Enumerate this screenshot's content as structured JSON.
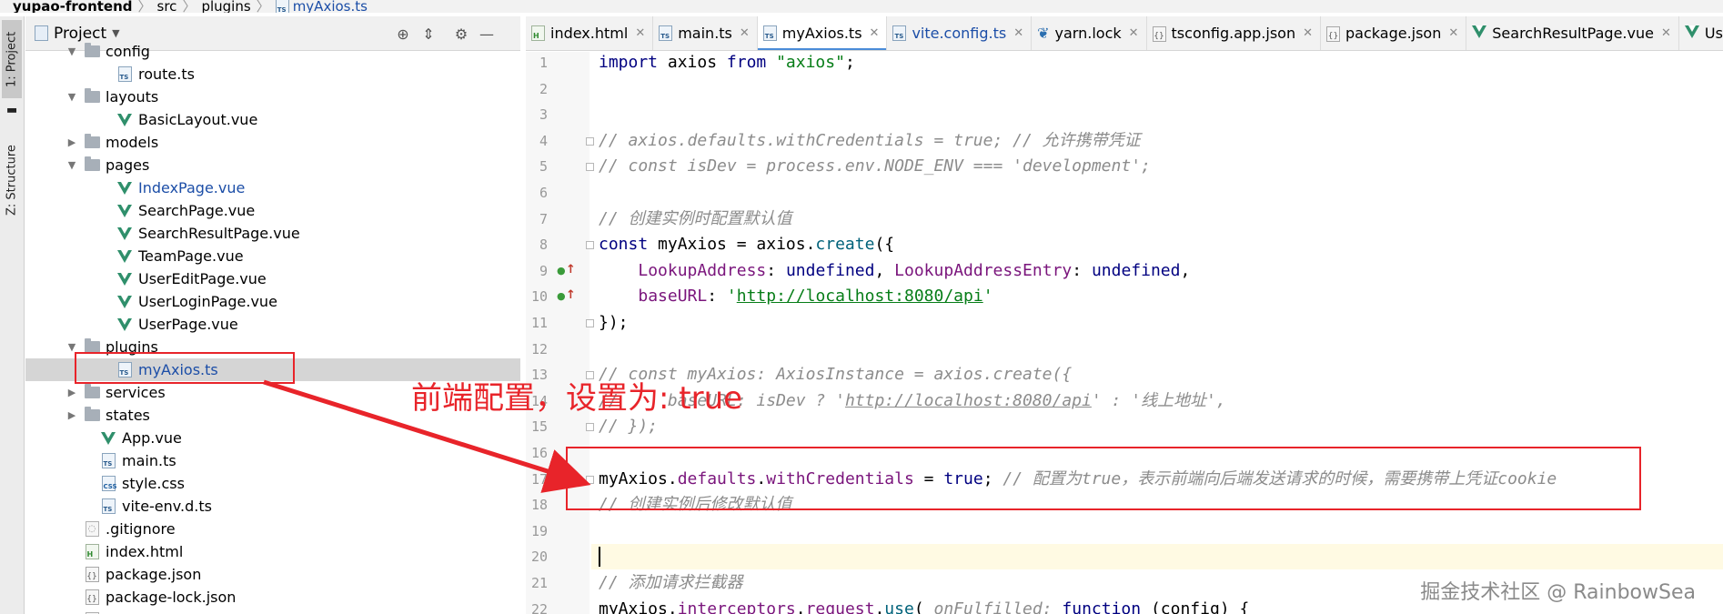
{
  "breadcrumb": [
    "yupao-frontend",
    "src",
    "plugins",
    "myAxios.ts"
  ],
  "toolstrip": {
    "project_tab": "1: Project",
    "structure_tab": "Z: Structure"
  },
  "project_panel": {
    "title": "Project",
    "tree": [
      {
        "label": "config",
        "kind": "folder",
        "expanded": true,
        "indent": 2
      },
      {
        "label": "route.ts",
        "kind": "ts",
        "indent": 4
      },
      {
        "label": "layouts",
        "kind": "folder",
        "expanded": true,
        "indent": 2
      },
      {
        "label": "BasicLayout.vue",
        "kind": "vue",
        "indent": 4
      },
      {
        "label": "models",
        "kind": "folder",
        "expanded": false,
        "indent": 2
      },
      {
        "label": "pages",
        "kind": "folder",
        "expanded": true,
        "indent": 2
      },
      {
        "label": "IndexPage.vue",
        "kind": "vue",
        "indent": 4,
        "highlight": true
      },
      {
        "label": "SearchPage.vue",
        "kind": "vue",
        "indent": 4
      },
      {
        "label": "SearchResultPage.vue",
        "kind": "vue",
        "indent": 4
      },
      {
        "label": "TeamPage.vue",
        "kind": "vue",
        "indent": 4
      },
      {
        "label": "UserEditPage.vue",
        "kind": "vue",
        "indent": 4
      },
      {
        "label": "UserLoginPage.vue",
        "kind": "vue",
        "indent": 4
      },
      {
        "label": "UserPage.vue",
        "kind": "vue",
        "indent": 4
      },
      {
        "label": "plugins",
        "kind": "folder",
        "expanded": true,
        "indent": 2
      },
      {
        "label": "myAxios.ts",
        "kind": "ts",
        "indent": 4,
        "selected": true
      },
      {
        "label": "services",
        "kind": "folder",
        "expanded": false,
        "indent": 2
      },
      {
        "label": "states",
        "kind": "folder",
        "expanded": false,
        "indent": 2
      },
      {
        "label": "App.vue",
        "kind": "vue",
        "indent": 3
      },
      {
        "label": "main.ts",
        "kind": "ts",
        "indent": 3
      },
      {
        "label": "style.css",
        "kind": "css",
        "indent": 3
      },
      {
        "label": "vite-env.d.ts",
        "kind": "ts",
        "indent": 3
      },
      {
        "label": ".gitignore",
        "kind": "git",
        "indent": 2
      },
      {
        "label": "index.html",
        "kind": "html",
        "indent": 2
      },
      {
        "label": "package.json",
        "kind": "json",
        "indent": 2
      },
      {
        "label": "package-lock.json",
        "kind": "json",
        "indent": 2
      },
      {
        "label": "README.md",
        "kind": "md",
        "indent": 2
      }
    ]
  },
  "tabs": [
    {
      "label": "index.html",
      "icon": "html"
    },
    {
      "label": "main.ts",
      "icon": "ts"
    },
    {
      "label": "myAxios.ts",
      "icon": "ts",
      "active": true
    },
    {
      "label": "vite.config.ts",
      "icon": "ts",
      "link": true
    },
    {
      "label": "yarn.lock",
      "icon": "yarn"
    },
    {
      "label": "tsconfig.app.json",
      "icon": "json"
    },
    {
      "label": "package.json",
      "icon": "json"
    },
    {
      "label": "SearchResultPage.vue",
      "icon": "vue"
    },
    {
      "label": "Use",
      "icon": "vue"
    }
  ],
  "editor": {
    "line_numbers": [
      "1",
      "2",
      "3",
      "4",
      "5",
      "6",
      "7",
      "8",
      "9",
      "10",
      "11",
      "12",
      "13",
      "14",
      "15",
      "16",
      "17",
      "18",
      "19",
      "20",
      "21",
      "22"
    ],
    "current_line": 20
  },
  "code_lines": [
    {
      "ln": 1,
      "parts": [
        [
          "kw",
          "import "
        ],
        [
          "var",
          "axios "
        ],
        [
          "kw",
          "from "
        ],
        [
          "str",
          "\"axios\""
        ],
        [
          "var",
          ";"
        ]
      ]
    },
    {
      "ln": 2,
      "parts": []
    },
    {
      "ln": 3,
      "parts": []
    },
    {
      "ln": 4,
      "parts": [
        [
          "cmt",
          "// axios.defaults.withCredentials = true; // 允许携带凭证"
        ]
      ]
    },
    {
      "ln": 5,
      "parts": [
        [
          "cmt",
          "// const isDev = process.env.NODE_ENV === 'development';"
        ]
      ]
    },
    {
      "ln": 6,
      "parts": []
    },
    {
      "ln": 7,
      "parts": [
        [
          "cmt",
          "// 创建实例时配置默认值"
        ]
      ]
    },
    {
      "ln": 8,
      "parts": [
        [
          "kw",
          "const "
        ],
        [
          "var",
          "myAxios = axios."
        ],
        [
          "fn",
          "create"
        ],
        [
          "var",
          "({"
        ]
      ]
    },
    {
      "ln": 9,
      "parts": [
        [
          "var",
          "    "
        ],
        [
          "prop",
          "LookupAddress"
        ],
        [
          "var",
          ": "
        ],
        [
          "kw",
          "undefined"
        ],
        [
          "var",
          ", "
        ],
        [
          "prop",
          "LookupAddressEntry"
        ],
        [
          "var",
          ": "
        ],
        [
          "kw",
          "undefined"
        ],
        [
          "var",
          ","
        ]
      ]
    },
    {
      "ln": 10,
      "parts": [
        [
          "var",
          "    "
        ],
        [
          "prop",
          "baseURL"
        ],
        [
          "var",
          ": "
        ],
        [
          "str",
          "'"
        ],
        [
          "url",
          "http://localhost:8080/api"
        ],
        [
          "str",
          "'"
        ]
      ]
    },
    {
      "ln": 11,
      "parts": [
        [
          "var",
          "});"
        ]
      ]
    },
    {
      "ln": 12,
      "parts": []
    },
    {
      "ln": 13,
      "parts": [
        [
          "cmt",
          "// const myAxios: AxiosInstance = axios.create({"
        ]
      ]
    },
    {
      "ln": 14,
      "parts": [
        [
          "cmt",
          "//     baseURL: isDev ? '"
        ],
        [
          "cmt-u",
          "http://localhost:8080/api"
        ],
        [
          "cmt",
          "' : '线上地址',"
        ]
      ]
    },
    {
      "ln": 15,
      "parts": [
        [
          "cmt",
          "// });"
        ]
      ]
    },
    {
      "ln": 16,
      "parts": []
    },
    {
      "ln": 17,
      "parts": [
        [
          "var",
          "myAxios."
        ],
        [
          "prop",
          "defaults"
        ],
        [
          "var",
          "."
        ],
        [
          "prop",
          "withCredentials"
        ],
        [
          "var",
          " = "
        ],
        [
          "kw",
          "true"
        ],
        [
          "var",
          "; "
        ],
        [
          "cmt",
          "// 配置为true，表示前端向后端发送请求的时候，需要携带上凭证cookie"
        ]
      ]
    },
    {
      "ln": 18,
      "parts": [
        [
          "cmt",
          "// 创建实例后修改默认值"
        ]
      ]
    },
    {
      "ln": 19,
      "parts": []
    },
    {
      "ln": 20,
      "parts": []
    },
    {
      "ln": 21,
      "parts": [
        [
          "cmt",
          "// 添加请求拦截器"
        ]
      ]
    },
    {
      "ln": 22,
      "parts": [
        [
          "var",
          "myAxios."
        ],
        [
          "prop",
          "interceptors"
        ],
        [
          "var",
          "."
        ],
        [
          "prop",
          "request"
        ],
        [
          "var",
          "."
        ],
        [
          "fn",
          "use"
        ],
        [
          "var",
          "( "
        ],
        [
          "cmt",
          "onFulfilled: "
        ],
        [
          "kw",
          "function "
        ],
        [
          "var",
          "(config) {"
        ]
      ]
    }
  ],
  "annotation": {
    "text": "前端配置，设置为: true",
    "color": "#e8242a"
  },
  "watermark": "掘金技术社区 @ RainbowSea"
}
